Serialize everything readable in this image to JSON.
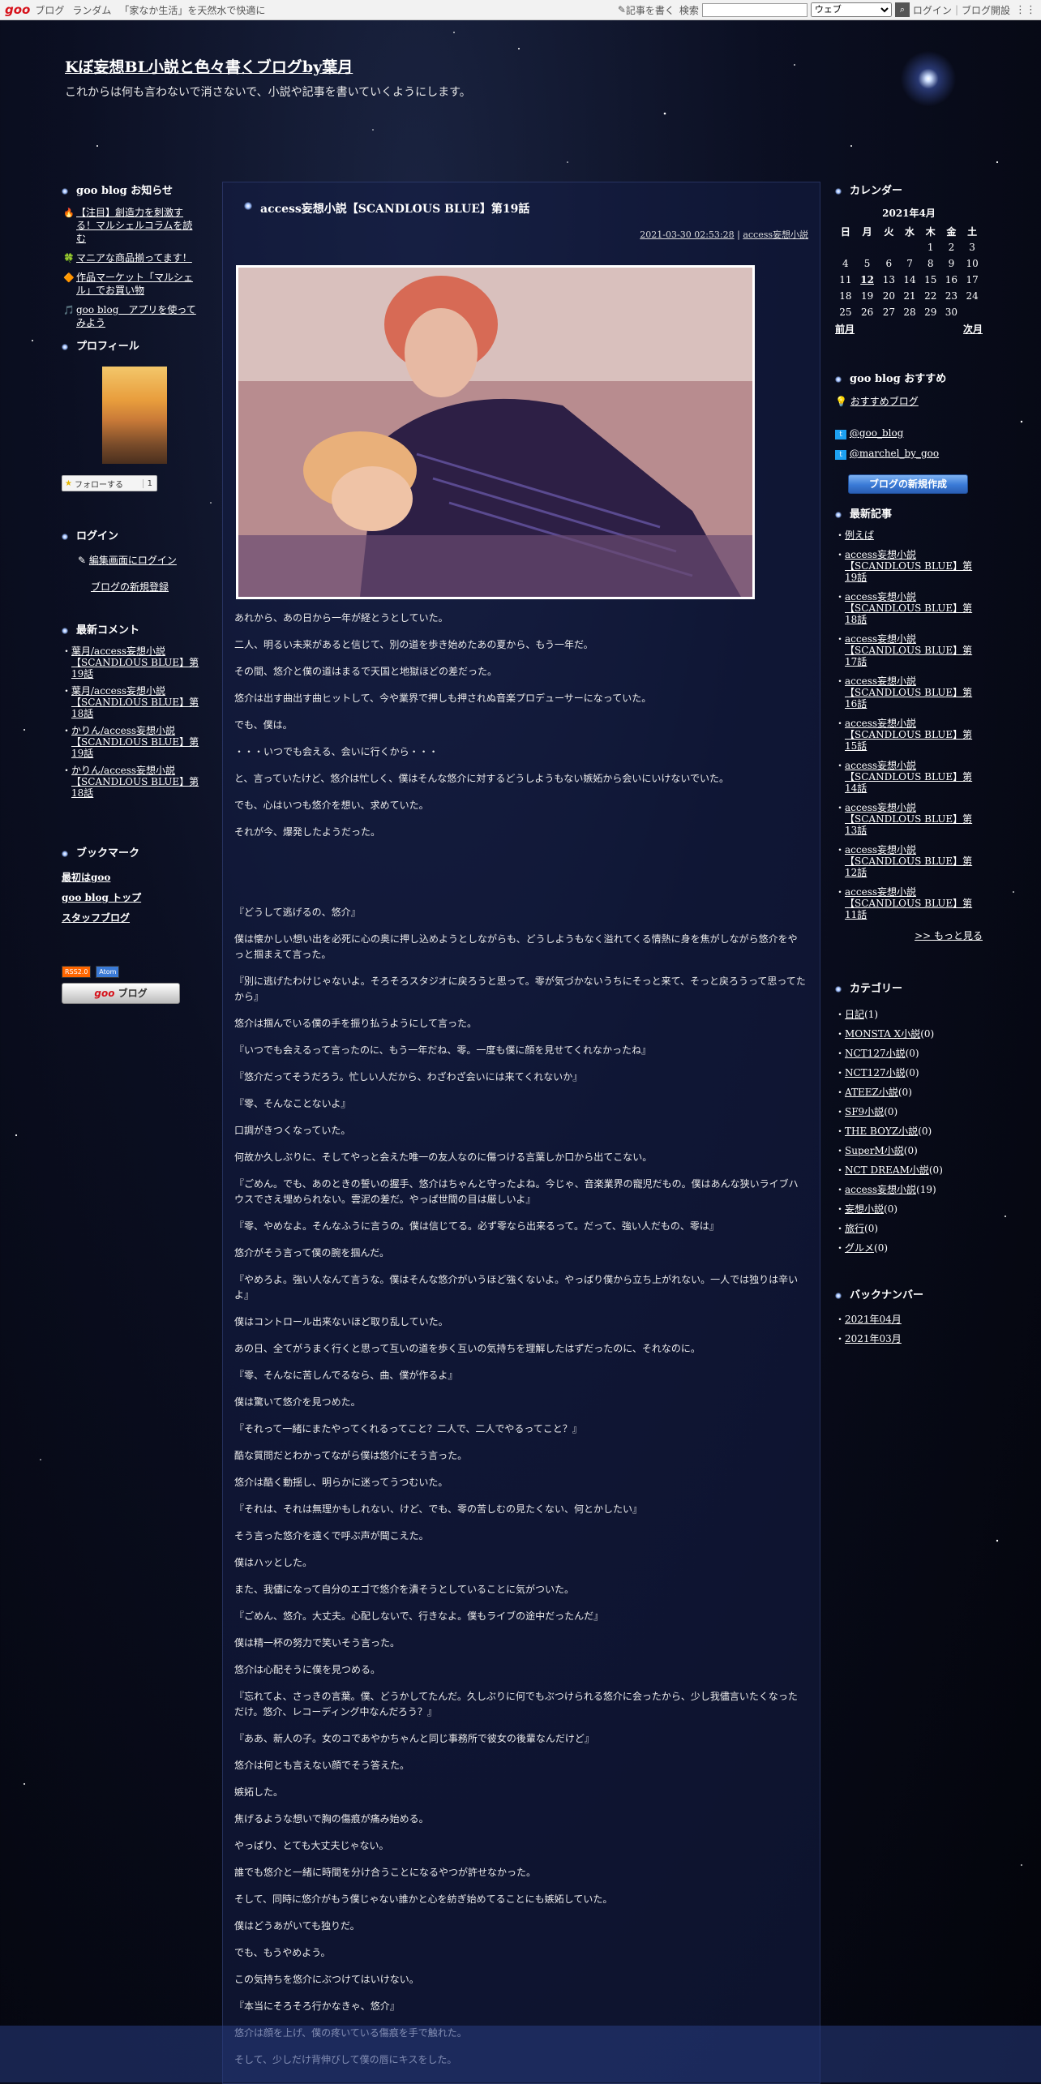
{
  "goobar": {
    "logo": "goo",
    "links": [
      "ブログ",
      "ランダム"
    ],
    "promo": "「家なか生活」を天然水で快適に",
    "write": "記事を書く",
    "search_label": "検索",
    "search_select": "ウェブ",
    "login": "ログイン",
    "open_blog": "ブログ開設"
  },
  "header": {
    "title": "Kぼ妄想BL小説と色々書くブログby葉月",
    "description": "これからは何も言わないで消さないで、小説や記事を書いていくようにします。"
  },
  "left": {
    "notice_heading": "goo blog お知らせ",
    "notices": [
      {
        "icon": "🔥",
        "text": "【注目】創造力を刺激する！マルシェルコラムを読む"
      },
      {
        "icon": "🍀",
        "text": "マニアな商品揃ってます！"
      },
      {
        "icon": "🔶",
        "text": "作品マーケット「マルシェル」でお買い物"
      },
      {
        "icon": "🎵",
        "text": "goo blog　アプリを使ってみよう"
      }
    ],
    "profile_heading": "プロフィール",
    "follow_label": "フォローする",
    "follow_count": "1",
    "login_heading": "ログイン",
    "login_edit": "編集画面にログイン",
    "login_new": "ブログの新規登録",
    "comments_heading": "最新コメント",
    "comments": [
      "葉月/access妄想小説【SCANDLOUS BLUE】第19話",
      "葉月/access妄想小説【SCANDLOUS BLUE】第18話",
      "かりん/access妄想小説【SCANDLOUS BLUE】第19話",
      "かりん/access妄想小説【SCANDLOUS BLUE】第18話"
    ],
    "bookmark_heading": "ブックマーク",
    "bookmarks": [
      "最初はgoo",
      "goo blog トップ",
      "スタッフブログ"
    ],
    "badges": [
      "RSS2.0",
      "Atom"
    ],
    "goo_button": "ブログ"
  },
  "entry": {
    "title": "access妄想小説【SCANDLOUS BLUE】第19話",
    "date": "2021-03-30 02:53:28",
    "category": "access妄想小説",
    "paragraphs": [
      "あれから、あの日から一年が経とうとしていた。",
      "二人、明るい未来があると信じて、別の道を歩き始めたあの夏から、もう一年だ。",
      "その間、悠介と僕の道はまるで天国と地獄ほどの差だった。",
      "悠介は出す曲出す曲ヒットして、今や業界で押しも押されぬ音楽プロデューサーになっていた。",
      "でも、僕は。",
      "・・・いつでも会える、会いに行くから・・・",
      "と、言っていたけど、悠介は忙しく、僕はそんな悠介に対するどうしようもない嫉妬から会いにいけないでいた。",
      "でも、心はいつも悠介を想い、求めていた。",
      "それが今、爆発したようだった。",
      "",
      "",
      "『どうして逃げるの、悠介』",
      "僕は懐かしい想い出を必死に心の奥に押し込めようとしながらも、どうしようもなく溢れてくる情熱に身を焦がしながら悠介をやっと掴まえて言った。",
      "『別に逃げたわけじゃないよ。そろそろスタジオに戻ろうと思って。零が気づかないうちにそっと来て、そっと戻ろうって思ってたから』",
      "悠介は掴んでいる僕の手を振り払うようにして言った。",
      "『いつでも会えるって言ったのに、もう一年だね、零。一度も僕に顔を見せてくれなかったね』",
      "『悠介だってそうだろう。忙しい人だから、わざわざ会いには来てくれないか』",
      "『零、そんなことないよ』",
      "口調がきつくなっていた。",
      "何故か久しぶりに、そしてやっと会えた唯一の友人なのに傷つける言葉しか口から出てこない。",
      "『ごめん。でも、あのときの誓いの握手、悠介はちゃんと守ったよね。今じゃ、音楽業界の寵児だもの。僕はあんな狭いライブハウスでさえ埋められない。雲泥の差だ。やっぱ世間の目は厳しいよ』",
      "『零、やめなよ。そんなふうに言うの。僕は信じてる。必ず零なら出来るって。だって、強い人だもの、零は』",
      "悠介がそう言って僕の腕を掴んだ。",
      "『やめろよ。強い人なんて言うな。僕はそんな悠介がいうほど強くないよ。やっぱり僕から立ち上がれない。一人では独りは辛いよ』",
      "僕はコントロール出来ないほど取り乱していた。",
      "あの日、全てがうまく行くと思って互いの道を歩く互いの気持ちを理解したはずだったのに、それなのに。",
      "『零、そんなに苦しんでるなら、曲、僕が作るよ』",
      "僕は驚いて悠介を見つめた。",
      "『それって一緒にまたやってくれるってこと？二人で、二人でやるってこと？』",
      "酷な質問だとわかってながら僕は悠介にそう言った。",
      "悠介は酷く動揺し、明らかに迷ってうつむいた。",
      "『それは、それは無理かもしれない、けど、でも、零の苦しむの見たくない、何とかしたい』",
      "そう言った悠介を遠くで呼ぶ声が聞こえた。",
      "僕はハッとした。",
      "また、我儘になって自分のエゴで悠介を潰そうとしていることに気がついた。",
      "『ごめん、悠介。大丈夫。心配しないで、行きなよ。僕もライブの途中だったんだ』",
      "僕は精一杯の努力で笑いそう言った。",
      "悠介は心配そうに僕を見つめる。",
      "『忘れてよ、さっきの言葉。僕、どうかしてたんだ。久しぶりに何でもぶつけられる悠介に会ったから、少し我儘言いたくなっただけ。悠介、レコーディング中なんだろう？』",
      "『ああ、新人の子。女のコであやかちゃんと同じ事務所で彼女の後輩なんだけど』",
      "悠介は何とも言えない顔でそう答えた。",
      "嫉妬した。",
      "焦げるような想いで胸の傷痕が痛み始める。",
      "やっぱり、とても大丈夫じゃない。",
      "誰でも悠介と一緒に時間を分け合うことになるやつが許せなかった。",
      "そして、同時に悠介がもう僕じゃない誰かと心を紡ぎ始めてることにも嫉妬していた。",
      "僕はどうあがいても独りだ。",
      "でも、もうやめよう。",
      "この気持ちを悠介にぶつけてはいけない。",
      "『本当にそろそろ行かなきゃ、悠介』",
      "悠介は顔を上げ、僕の疼いている傷痕を手で触れた。",
      "そして、少しだけ背伸びして僕の唇にキスをした。"
    ]
  },
  "right": {
    "calendar_heading": "カレンダー",
    "calendar_caption": "2021年4月",
    "weekdays": [
      "日",
      "月",
      "火",
      "水",
      "木",
      "金",
      "土"
    ],
    "weeks": [
      [
        "",
        "",
        "",
        "",
        "1",
        "2",
        "3"
      ],
      [
        "4",
        "5",
        "6",
        "7",
        "8",
        "9",
        "10"
      ],
      [
        "11",
        "12",
        "13",
        "14",
        "15",
        "16",
        "17"
      ],
      [
        "18",
        "19",
        "20",
        "21",
        "22",
        "23",
        "24"
      ],
      [
        "25",
        "26",
        "27",
        "28",
        "29",
        "30",
        ""
      ]
    ],
    "today": "12",
    "prev": "前月",
    "next": "次月",
    "recommend_heading": "goo blog おすすめ",
    "recommend_link": "おすすめブログ",
    "twitter": [
      "@goo_blog",
      "@marchel_by_goo"
    ],
    "new_blog_button": "ブログの新規作成",
    "recent_heading": "最新記事",
    "recent": [
      "例えば",
      "access妄想小説【SCANDLOUS BLUE】第19話",
      "access妄想小説【SCANDLOUS BLUE】第18話",
      "access妄想小説【SCANDLOUS BLUE】第17話",
      "access妄想小説【SCANDLOUS BLUE】第16話",
      "access妄想小説【SCANDLOUS BLUE】第15話",
      "access妄想小説【SCANDLOUS BLUE】第14話",
      "access妄想小説【SCANDLOUS BLUE】第13話",
      "access妄想小説【SCANDLOUS BLUE】第12話",
      "access妄想小説【SCANDLOUS BLUE】第11話"
    ],
    "more": ">> もっと見る",
    "category_heading": "カテゴリー",
    "categories": [
      {
        "name": "日記",
        "count": "(1)"
      },
      {
        "name": "MONSTA X小説",
        "count": "(0)"
      },
      {
        "name": "NCT127小説",
        "count": "(0)"
      },
      {
        "name": "NCT127小説",
        "count": "(0)"
      },
      {
        "name": "ATEEZ小説",
        "count": "(0)"
      },
      {
        "name": "SF9小説",
        "count": "(0)"
      },
      {
        "name": "THE BOYZ小説",
        "count": "(0)"
      },
      {
        "name": "SuperM小説",
        "count": "(0)"
      },
      {
        "name": "NCT DREAM小説",
        "count": "(0)"
      },
      {
        "name": "access妄想小説",
        "count": "(19)"
      },
      {
        "name": "妄想小説",
        "count": "(0)"
      },
      {
        "name": "旅行",
        "count": "(0)"
      },
      {
        "name": "グルメ",
        "count": "(0)"
      }
    ],
    "backnumber_heading": "バックナンバー",
    "backnumbers": [
      "2021年04月",
      "2021年03月"
    ]
  }
}
